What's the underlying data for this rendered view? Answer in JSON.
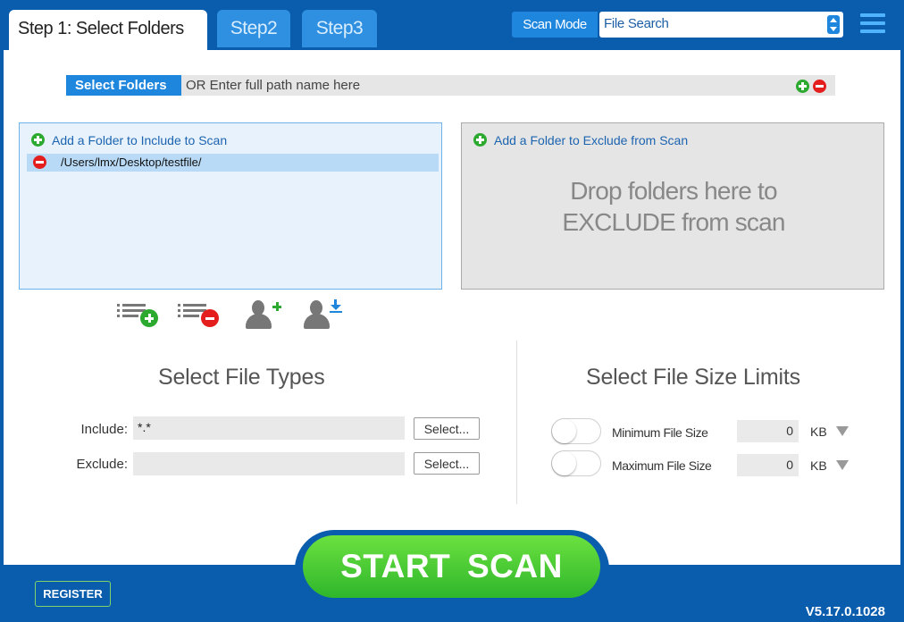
{
  "tabs": {
    "step1": "Step 1: Select Folders",
    "step2": "Step2",
    "step3": "Step3"
  },
  "scan_mode": {
    "label": "Scan Mode",
    "value": "File Search"
  },
  "path_bar": {
    "button": "Select Folders",
    "placeholder": "OR Enter full path name here"
  },
  "include_panel": {
    "header": "Add a Folder to Include to Scan",
    "items": [
      "/Users/lmx/Desktop/testfile/"
    ]
  },
  "exclude_panel": {
    "header": "Add a Folder to Exclude from Scan",
    "drop_line1": "Drop folders here to",
    "drop_line2": "EXCLUDE from scan"
  },
  "file_types": {
    "title": "Select File Types",
    "include_label": "Include:",
    "include_value": "*.*",
    "exclude_label": "Exclude:",
    "exclude_value": "",
    "select_label": "Select..."
  },
  "file_size": {
    "title": "Select File Size Limits",
    "min_label": "Minimum File Size",
    "min_value": "0",
    "max_label": "Maximum File Size",
    "max_value": "0",
    "unit": "KB"
  },
  "footer": {
    "start": "START SCAN",
    "register": "REGISTER",
    "version": "V5.17.0.1028"
  },
  "colors": {
    "brand_blue": "#0a5cad",
    "accent_blue": "#1f86de",
    "start_green": "#2fb62c"
  },
  "icons": [
    "hamburger-menu-icon",
    "add-icon",
    "remove-icon",
    "add-list-icon",
    "remove-list-icon",
    "add-user-icon",
    "user-download-icon",
    "dropdown-arrow-icon"
  ]
}
